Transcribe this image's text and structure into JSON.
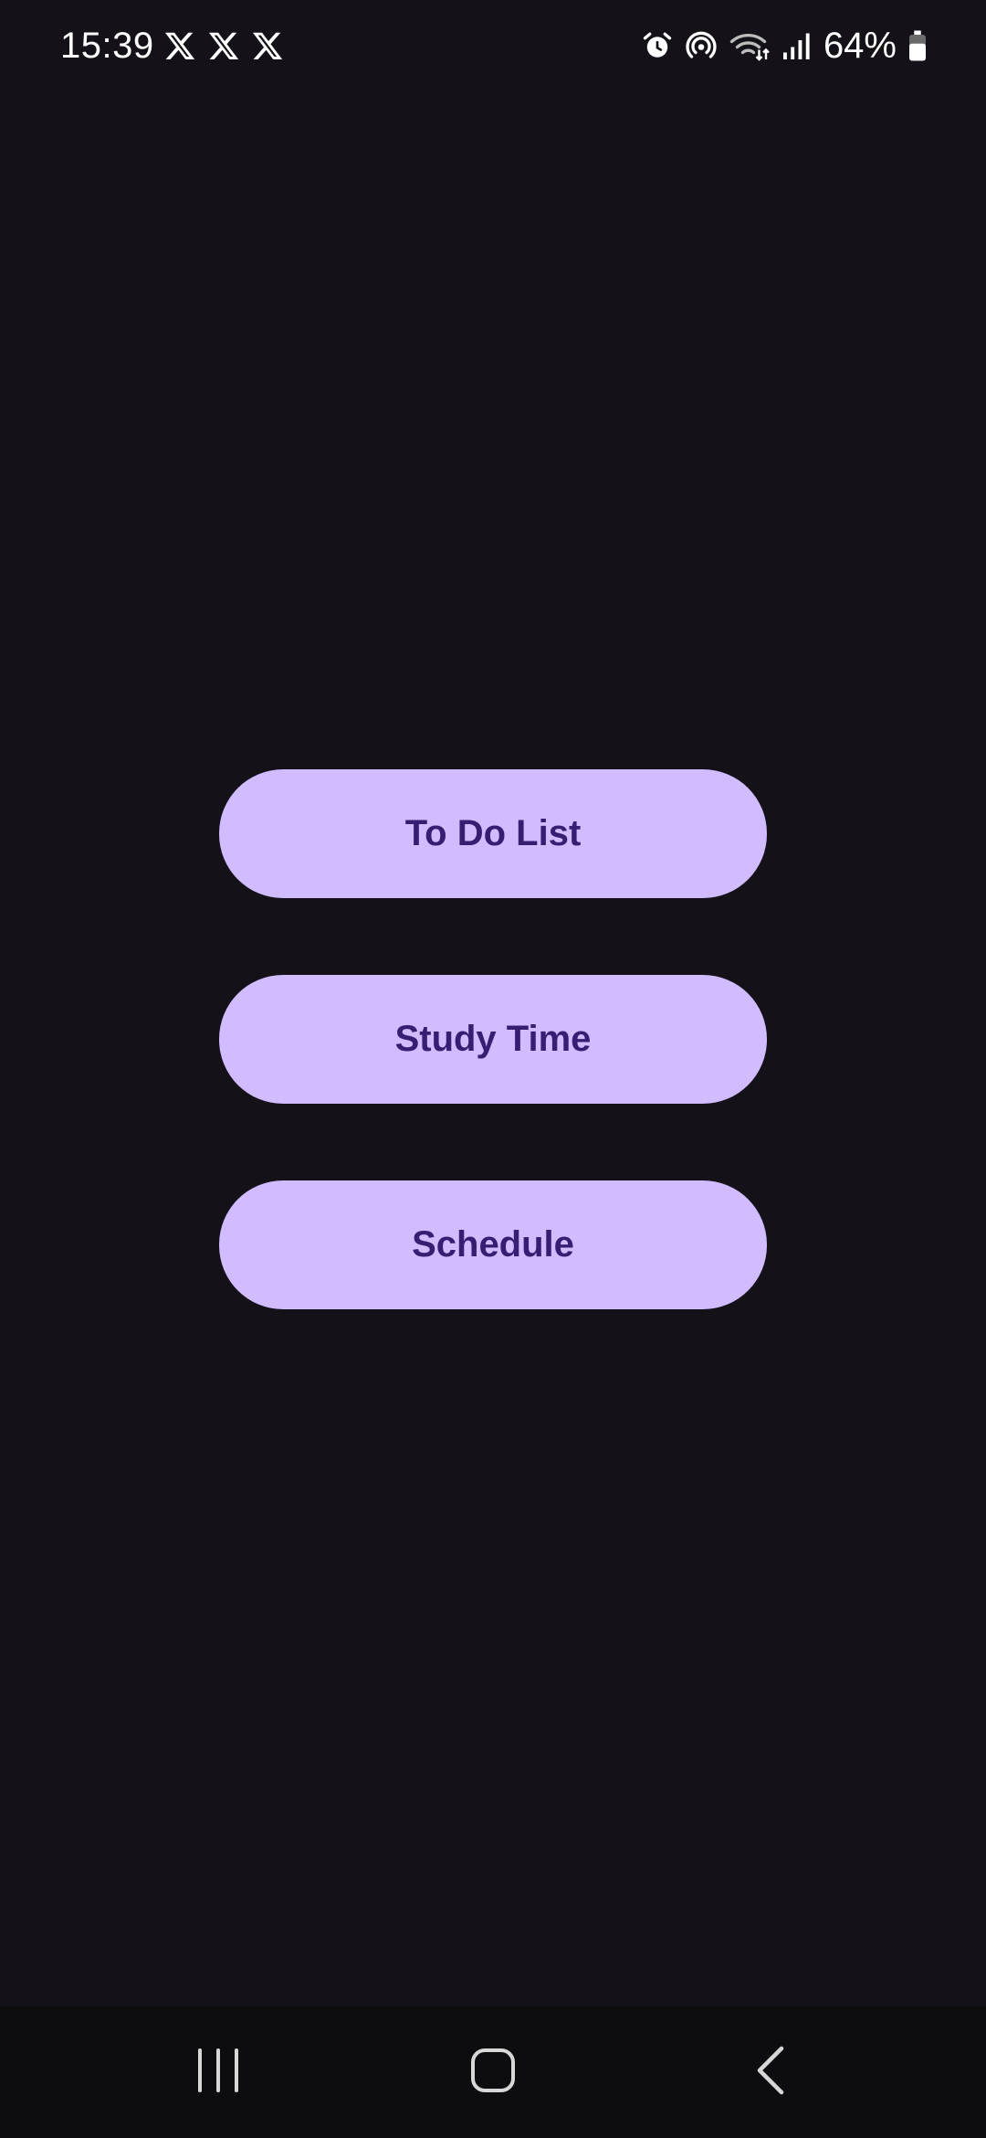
{
  "status_bar": {
    "time": "15:39",
    "notification_icons": [
      "x-icon",
      "x-icon",
      "x-icon"
    ],
    "system_icons": [
      "alarm-icon",
      "hotspot-icon",
      "wifi-icon",
      "signal-icon",
      "battery-icon"
    ],
    "battery_percent": "64%"
  },
  "menu": {
    "buttons": [
      {
        "label": "To Do List"
      },
      {
        "label": "Study Time"
      },
      {
        "label": "Schedule"
      }
    ]
  },
  "nav_bar": {
    "icons": [
      "recents-icon",
      "home-icon",
      "back-icon"
    ]
  },
  "colors": {
    "background": "#141218",
    "button_bg": "#d0bcff",
    "button_text": "#381e72",
    "nav_bg": "#0d0d0f"
  }
}
